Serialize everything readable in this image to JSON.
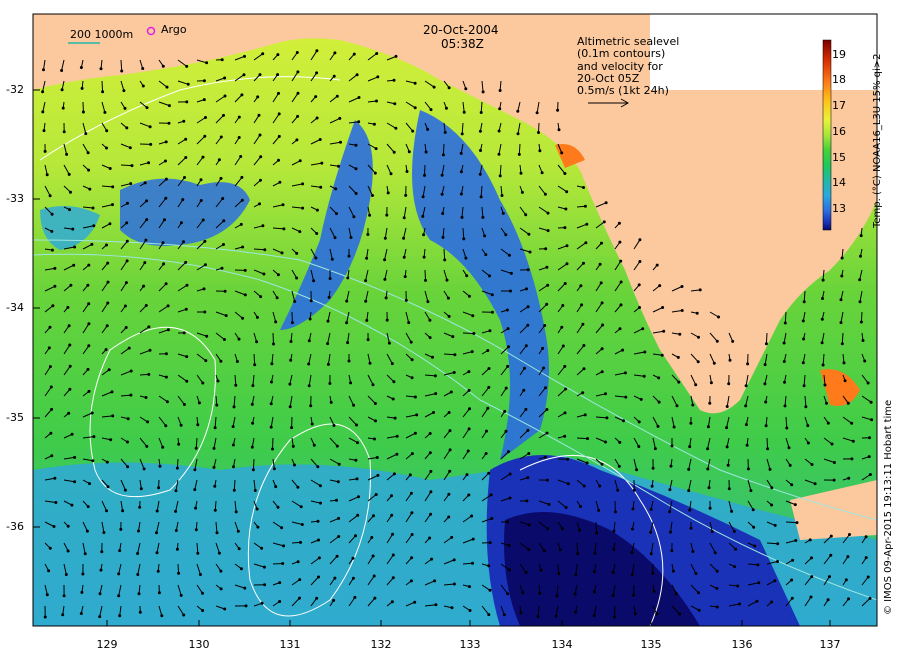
{
  "header": {
    "date": "20-Oct-2004",
    "time": "05:38Z",
    "depth_legend": "200  1000m",
    "argo_legend": "Argo"
  },
  "velocity_note": {
    "line1": "Altimetric sealevel",
    "line2": "(0.1m contours)",
    "line3": "and velocity for",
    "line4": "20-Oct 05Z",
    "line5": "0.5m/s (1kt 24h)"
  },
  "colorbar": {
    "title": "Temp. (°C) NOAA16_L3U 15% qi>2",
    "ticks": [
      "19",
      "18",
      "17",
      "16",
      "15",
      "14",
      "13"
    ],
    "colors": [
      "#7a0000",
      "#d42a00",
      "#ff7a1a",
      "#ffc21a",
      "#e9f23a",
      "#a8e63a",
      "#45d13a",
      "#1ec85a",
      "#22b8a8",
      "#2aa8e0",
      "#2b6ee0",
      "#1a32b8",
      "#0a0a6a"
    ]
  },
  "axes": {
    "lat_ticks": [
      "-32",
      "-33",
      "-34",
      "-35",
      "-36"
    ],
    "lon_ticks": [
      "129",
      "130",
      "131",
      "132",
      "133",
      "134",
      "135",
      "136",
      "137"
    ]
  },
  "credit": "© IMOS 09-Apr-2015 19:13:11 Hobart time",
  "colors": {
    "land": "#fbc99d",
    "sea_warm": "#a8e63a",
    "sea_mid": "#45d13a",
    "sea_cool": "#22b8a8",
    "sea_cold": "#1a32b8"
  }
}
